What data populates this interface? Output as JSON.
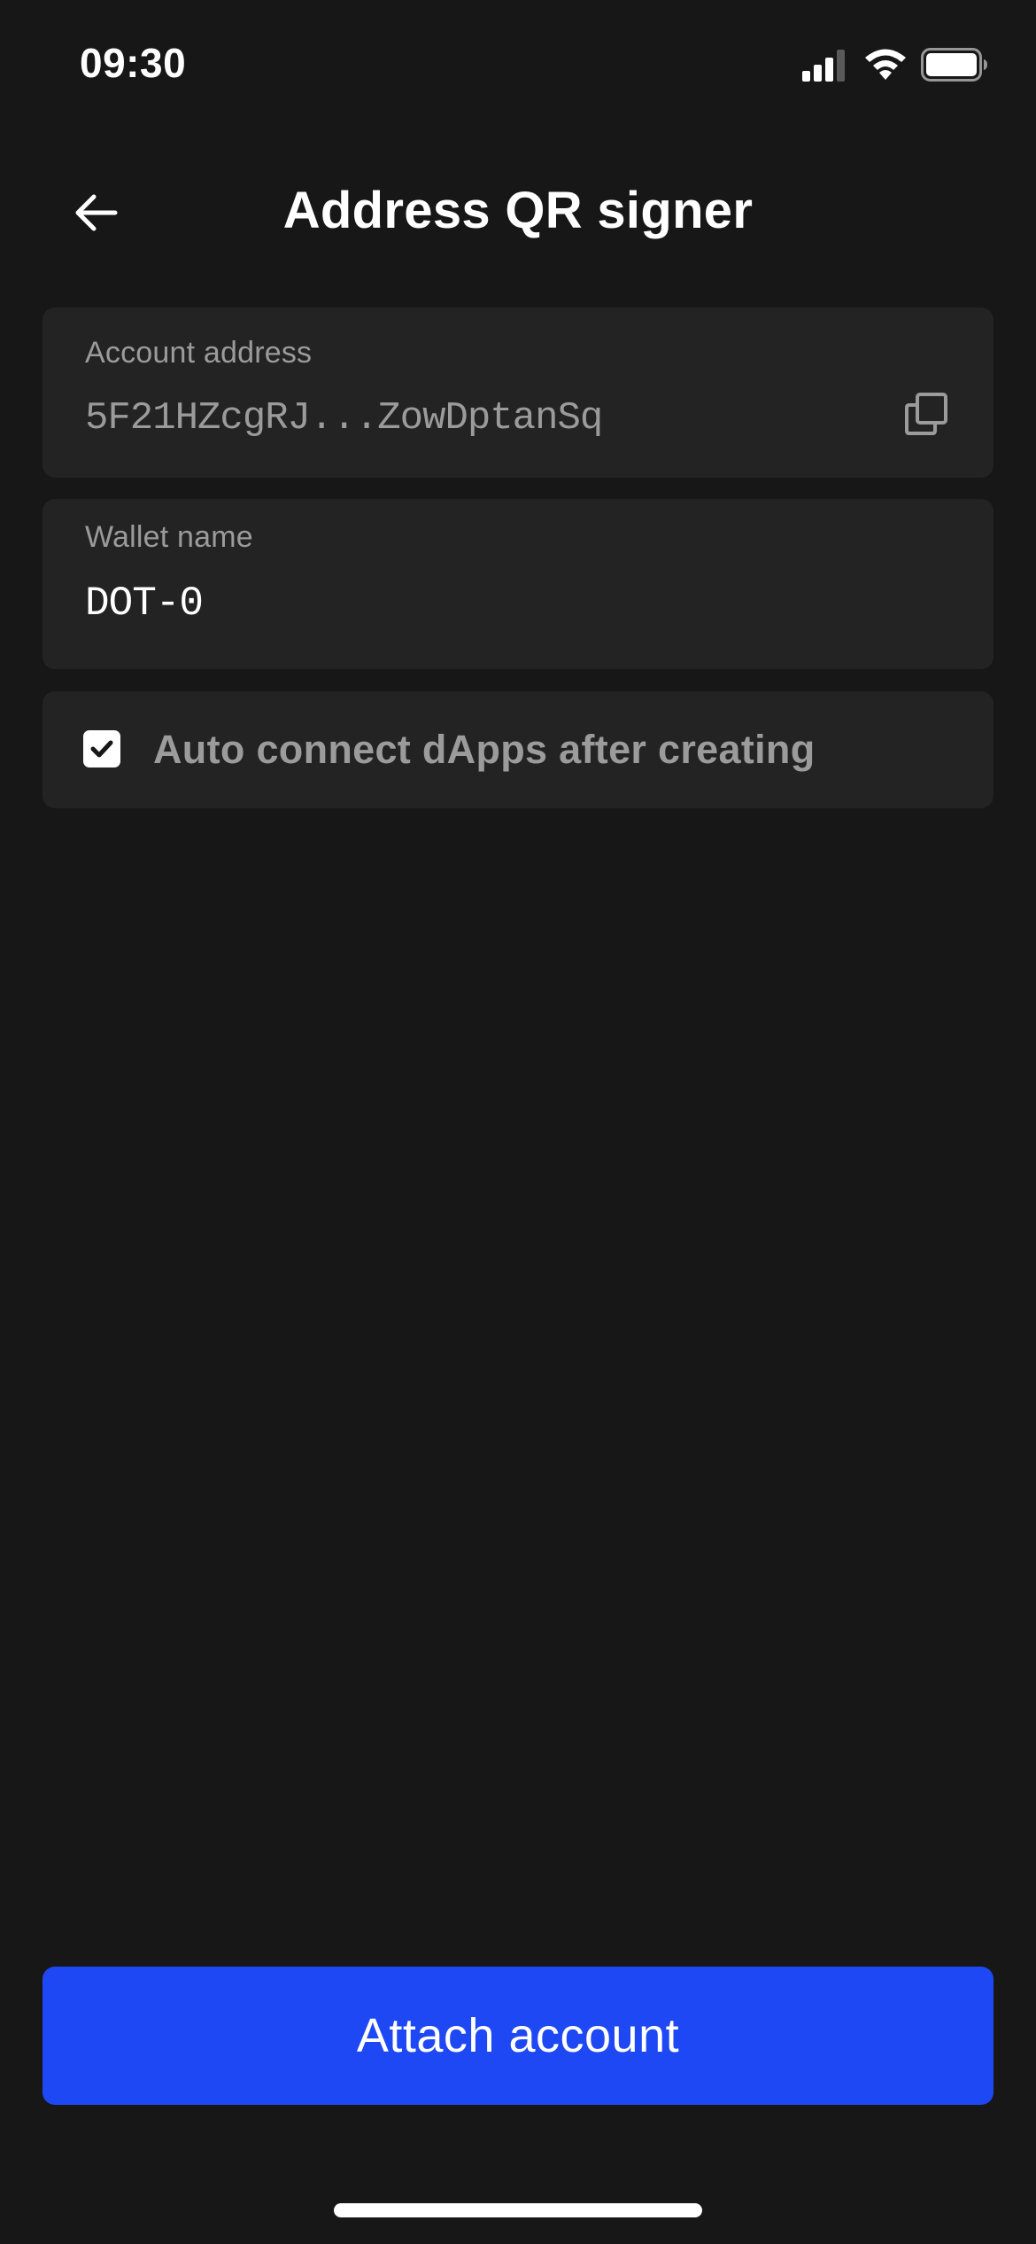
{
  "status_bar": {
    "time": "09:30",
    "icons": [
      "signal-icon",
      "wifi-icon",
      "battery-icon"
    ]
  },
  "header": {
    "back_icon": "arrow-left-icon",
    "title": "Address QR signer"
  },
  "account_address": {
    "label": "Account address",
    "value": "5F21HZcgRJ...ZowDptanSq",
    "copy_icon": "copy-icon"
  },
  "wallet_name": {
    "label": "Wallet name",
    "value": "DOT-0"
  },
  "auto_connect": {
    "label": "Auto connect dApps after creating",
    "checked": true,
    "icon": "checkmark-icon"
  },
  "attach_button": {
    "label": "Attach account"
  },
  "colors": {
    "background": "#171717",
    "card": "#232323",
    "accent": "#1f48f5",
    "muted_text": "#9b9b9b",
    "text": "#ffffff"
  }
}
